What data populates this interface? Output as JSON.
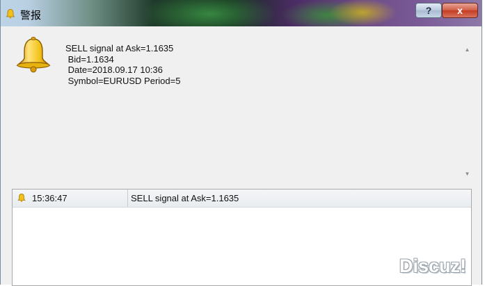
{
  "window": {
    "title": "警报",
    "help_label": "?",
    "close_label": "x"
  },
  "alert": {
    "line1": "SELL signal at Ask=1.1635",
    "line2": " Bid=1.1634",
    "line3": " Date=2018.09.17 10:36",
    "line4": " Symbol=EURUSD Period=5"
  },
  "scrollbar": {
    "up_glyph": "▲",
    "down_glyph": "▼"
  },
  "alert_list": {
    "rows": [
      {
        "time": "15:36:47",
        "message": "SELL signal at Ask=1.1635"
      }
    ]
  },
  "watermark": "Discuz!",
  "icons": {
    "title": "bell-icon",
    "alert": "bell-icon",
    "row": "bell-icon"
  },
  "colors": {
    "bell_gold": "#f2c21a",
    "close_red": "#c43b22"
  }
}
